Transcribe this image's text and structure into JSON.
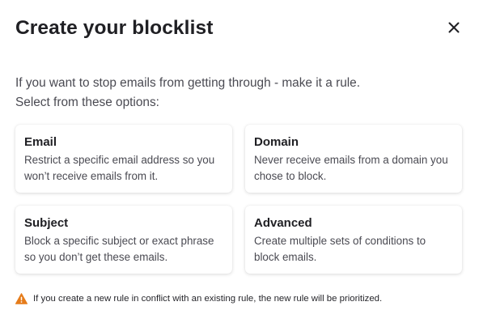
{
  "dialog": {
    "title": "Create your blocklist",
    "close_icon": "close-icon",
    "intro_line1": "If you want to stop emails from getting through - make it a rule.",
    "intro_line2": "Select from these options:"
  },
  "options": [
    {
      "title": "Email",
      "description": "Restrict a specific email address so you won’t receive emails from it."
    },
    {
      "title": "Domain",
      "description": "Never receive emails from a domain you chose to block."
    },
    {
      "title": "Subject",
      "description": "Block a specific subject or exact phrase so you don’t get these emails."
    },
    {
      "title": "Advanced",
      "description": "Create multiple sets of conditions to block emails."
    }
  ],
  "warning": {
    "icon": "warning-icon",
    "icon_color": "#e57c1b",
    "text": "If you create a new rule in conflict with an existing rule, the new rule will be prioritized."
  }
}
